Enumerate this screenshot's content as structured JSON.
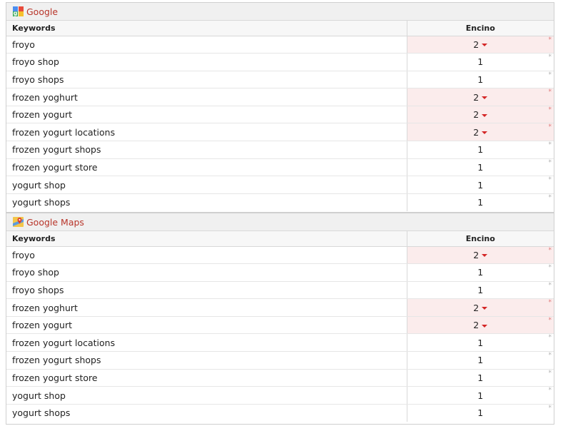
{
  "colors": {
    "engine_title": "#b8352a",
    "worse_row_bg": "#fbecec",
    "arrow_down": "#d42626"
  },
  "sections": [
    {
      "engine": "Google",
      "icon": "google-icon",
      "headers": {
        "keyword": "Keywords",
        "location": "Encino"
      },
      "rows": [
        {
          "keyword": "froyo",
          "rank": "2",
          "change": "down",
          "marker": "*"
        },
        {
          "keyword": "froyo shop",
          "rank": "1",
          "change": "none",
          "marker": "*"
        },
        {
          "keyword": "froyo shops",
          "rank": "1",
          "change": "none",
          "marker": "*"
        },
        {
          "keyword": "frozen yoghurt",
          "rank": "2",
          "change": "down",
          "marker": "*"
        },
        {
          "keyword": "frozen yogurt",
          "rank": "2",
          "change": "down",
          "marker": "*"
        },
        {
          "keyword": "frozen yogurt locations",
          "rank": "2",
          "change": "down",
          "marker": "*"
        },
        {
          "keyword": "frozen yogurt shops",
          "rank": "1",
          "change": "none",
          "marker": "*"
        },
        {
          "keyword": "frozen yogurt store",
          "rank": "1",
          "change": "none",
          "marker": "*"
        },
        {
          "keyword": "yogurt shop",
          "rank": "1",
          "change": "none",
          "marker": "*"
        },
        {
          "keyword": "yogurt shops",
          "rank": "1",
          "change": "none",
          "marker": "*"
        }
      ]
    },
    {
      "engine": "Google Maps",
      "icon": "google-maps-icon",
      "headers": {
        "keyword": "Keywords",
        "location": "Encino"
      },
      "rows": [
        {
          "keyword": "froyo",
          "rank": "2",
          "change": "down",
          "marker": "*"
        },
        {
          "keyword": "froyo shop",
          "rank": "1",
          "change": "none",
          "marker": "*"
        },
        {
          "keyword": "froyo shops",
          "rank": "1",
          "change": "none",
          "marker": "*"
        },
        {
          "keyword": "frozen yoghurt",
          "rank": "2",
          "change": "down",
          "marker": "*"
        },
        {
          "keyword": "frozen yogurt",
          "rank": "2",
          "change": "down",
          "marker": "*"
        },
        {
          "keyword": "frozen yogurt locations",
          "rank": "1",
          "change": "none",
          "marker": "*"
        },
        {
          "keyword": "frozen yogurt shops",
          "rank": "1",
          "change": "none",
          "marker": "*"
        },
        {
          "keyword": "frozen yogurt store",
          "rank": "1",
          "change": "none",
          "marker": "*"
        },
        {
          "keyword": "yogurt shop",
          "rank": "1",
          "change": "none",
          "marker": "*"
        },
        {
          "keyword": "yogurt shops",
          "rank": "1",
          "change": "none",
          "marker": "*"
        }
      ]
    }
  ]
}
